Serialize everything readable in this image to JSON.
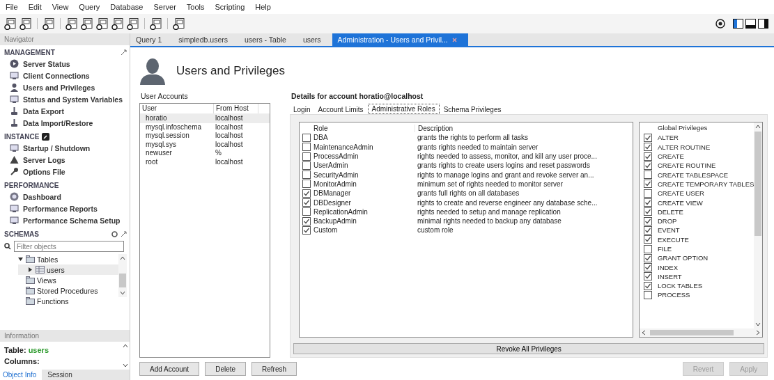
{
  "menu": [
    "File",
    "Edit",
    "View",
    "Query",
    "Database",
    "Server",
    "Tools",
    "Scripting",
    "Help"
  ],
  "navigator": {
    "title": "Navigator",
    "sections": [
      {
        "title": "MANAGEMENT",
        "items": [
          "Server Status",
          "Client Connections",
          "Users and Privileges",
          "Status and System Variables",
          "Data Export",
          "Data Import/Restore"
        ]
      },
      {
        "title": "INSTANCE",
        "items": [
          "Startup / Shutdown",
          "Server Logs",
          "Options File"
        ]
      },
      {
        "title": "PERFORMANCE",
        "items": [
          "Dashboard",
          "Performance Reports",
          "Performance Schema Setup"
        ]
      }
    ],
    "schemas": {
      "title": "SCHEMAS",
      "search": {
        "placeholder": "Filter objects"
      },
      "tree": [
        {
          "label": "Tables",
          "expanded": true,
          "selected": false,
          "children": [
            {
              "label": "users",
              "expanded": false,
              "selected": true
            }
          ]
        },
        {
          "label": "Views",
          "selected": false
        },
        {
          "label": "Stored Procedures",
          "selected": false
        },
        {
          "label": "Functions",
          "selected": false
        }
      ]
    },
    "information": {
      "title": "Information",
      "table_label": "Table:",
      "table_name": "users",
      "columns_label": "Columns:",
      "tabs": [
        {
          "label": "Object Info",
          "selected": true
        },
        {
          "label": "Session",
          "selected": false
        }
      ]
    }
  },
  "tabs": [
    {
      "label": "Query 1",
      "selected": false
    },
    {
      "label": "simpledb.users",
      "selected": false
    },
    {
      "label": "users - Table",
      "selected": false
    },
    {
      "label": "users",
      "selected": false
    },
    {
      "label": "Administration - Users and Privil...",
      "selected": true
    }
  ],
  "page": {
    "title": "Users and Privileges"
  },
  "accounts": {
    "label": "User Accounts",
    "columns": [
      "User",
      "From Host"
    ],
    "rows": [
      {
        "user": "horatio",
        "host": "localhost",
        "selected": true
      },
      {
        "user": "mysql.infoschema",
        "host": "localhost",
        "selected": false
      },
      {
        "user": "mysql.session",
        "host": "localhost",
        "selected": false
      },
      {
        "user": "mysql.sys",
        "host": "localhost",
        "selected": false
      },
      {
        "user": "newuser",
        "host": "%",
        "selected": false
      },
      {
        "user": "root",
        "host": "localhost",
        "selected": false
      }
    ],
    "buttons": [
      "Add Account",
      "Delete",
      "Refresh"
    ]
  },
  "details": {
    "title": "Details for account horatio@localhost",
    "tabs": [
      {
        "label": "Login",
        "selected": false
      },
      {
        "label": "Account Limits",
        "selected": false
      },
      {
        "label": "Administrative Roles",
        "selected": true
      },
      {
        "label": "Schema Privileges",
        "selected": false
      }
    ],
    "roles": {
      "columns": [
        "Role",
        "Description"
      ],
      "rows": [
        {
          "role": "DBA",
          "description": "grants the rights to perform all tasks",
          "checked": false
        },
        {
          "role": "MaintenanceAdmin",
          "description": "grants rights needed to maintain server",
          "checked": false
        },
        {
          "role": "ProcessAdmin",
          "description": "rights needed to assess, monitor, and kill any user proce...",
          "checked": false
        },
        {
          "role": "UserAdmin",
          "description": "grants rights to create users logins and reset passwords",
          "checked": false
        },
        {
          "role": "SecurityAdmin",
          "description": "rights to manage logins and grant and revoke server an...",
          "checked": false
        },
        {
          "role": "MonitorAdmin",
          "description": "minimum set of rights needed to monitor server",
          "checked": false
        },
        {
          "role": "DBManager",
          "description": "grants full rights on all databases",
          "checked": true
        },
        {
          "role": "DBDesigner",
          "description": "rights to create and reverse engineer any database sche...",
          "checked": true
        },
        {
          "role": "ReplicationAdmin",
          "description": "rights needed to setup and manage replication",
          "checked": false
        },
        {
          "role": "BackupAdmin",
          "description": "minimal rights needed to backup any database",
          "checked": true
        },
        {
          "role": "Custom",
          "description": "custom role",
          "checked": true
        }
      ]
    },
    "privileges": {
      "column": "Global Privileges",
      "items": [
        {
          "name": "ALTER",
          "checked": true
        },
        {
          "name": "ALTER ROUTINE",
          "checked": true
        },
        {
          "name": "CREATE",
          "checked": true
        },
        {
          "name": "CREATE ROUTINE",
          "checked": true
        },
        {
          "name": "CREATE TABLESPACE",
          "checked": false
        },
        {
          "name": "CREATE TEMPORARY TABLES",
          "checked": true
        },
        {
          "name": "CREATE USER",
          "checked": false
        },
        {
          "name": "CREATE VIEW",
          "checked": true
        },
        {
          "name": "DELETE",
          "checked": true
        },
        {
          "name": "DROP",
          "checked": true
        },
        {
          "name": "EVENT",
          "checked": true
        },
        {
          "name": "EXECUTE",
          "checked": true
        },
        {
          "name": "FILE",
          "checked": false
        },
        {
          "name": "GRANT OPTION",
          "checked": true
        },
        {
          "name": "INDEX",
          "checked": true
        },
        {
          "name": "INSERT",
          "checked": true
        },
        {
          "name": "LOCK TABLES",
          "checked": true
        },
        {
          "name": "PROCESS",
          "checked": false
        }
      ]
    },
    "revoke_button": "Revoke All Privileges",
    "buttons": [
      {
        "label": "Revert",
        "disabled": true
      },
      {
        "label": "Apply",
        "disabled": true
      }
    ]
  }
}
